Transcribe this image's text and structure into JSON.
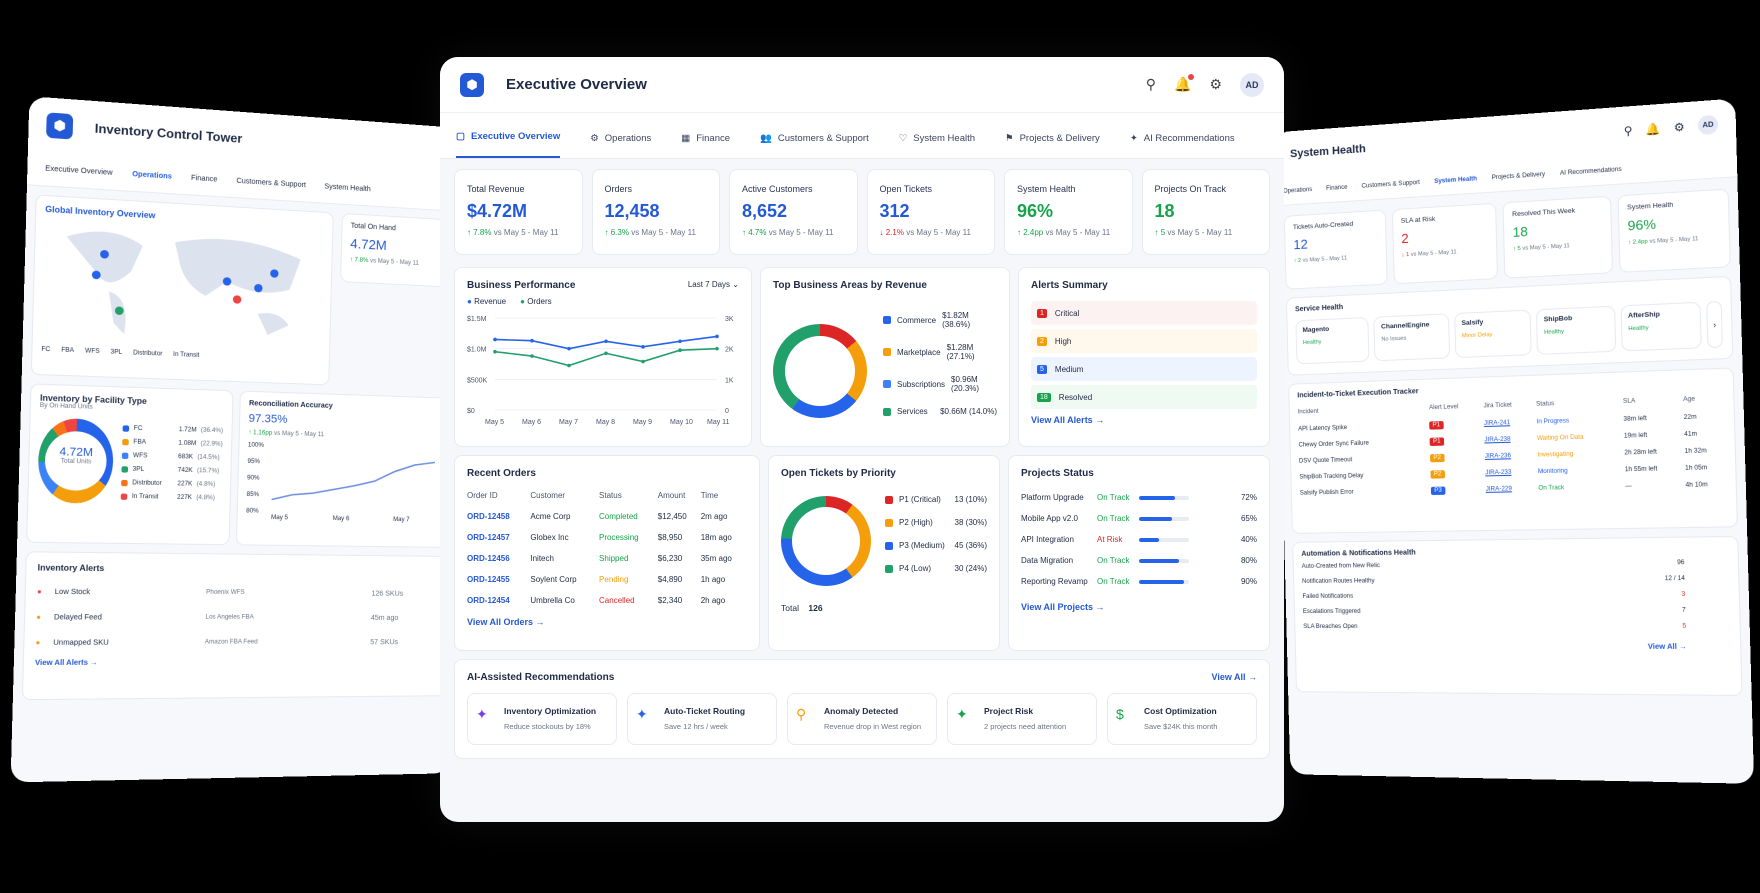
{
  "left": {
    "title": "Inventory Control Tower",
    "tabs": [
      "Executive Overview",
      "Operations",
      "Finance",
      "Customers & Support",
      "System Health"
    ],
    "map_title": "Global Inventory Overview",
    "map_legend": [
      "FC",
      "FBA",
      "WFS",
      "3PL",
      "Distributor",
      "In Transit"
    ],
    "onhand": {
      "label": "Total On Hand",
      "value": "4.72M",
      "delta": "↑ 7.8%",
      "vs": "vs May 5 - May 11"
    },
    "facility": {
      "title": "Inventory by Facility Type",
      "subtitle": "By On Hand Units",
      "center_value": "4.72M",
      "center_label": "Total Units",
      "rows": [
        {
          "name": "FC",
          "value": "1.72M",
          "pct": "(36.4%)",
          "color": "#2563eb"
        },
        {
          "name": "FBA",
          "value": "1.08M",
          "pct": "(22.9%)",
          "color": "#f59e0b"
        },
        {
          "name": "WFS",
          "value": "683K",
          "pct": "(14.5%)",
          "color": "#3b82f6"
        },
        {
          "name": "3PL",
          "value": "742K",
          "pct": "(15.7%)",
          "color": "#22a06b"
        },
        {
          "name": "Distributor",
          "value": "227K",
          "pct": "(4.8%)",
          "color": "#f97316"
        },
        {
          "name": "In Transit",
          "value": "227K",
          "pct": "(4.8%)",
          "color": "#ef4444"
        }
      ]
    },
    "recon": {
      "title": "Reconciliation Accuracy",
      "value": "97.35%",
      "delta": "↑ 1.16pp",
      "vs": "vs May 5 - May 11",
      "yticks": [
        "100%",
        "95%",
        "90%",
        "85%",
        "80%"
      ],
      "xticks": [
        "May 5",
        "May 6",
        "May 7"
      ]
    },
    "alerts": {
      "title": "Inventory Alerts",
      "rows": [
        {
          "name": "Low Stock",
          "loc": "Phoenix WFS",
          "val": "126 SKUs",
          "color": "#ef4444"
        },
        {
          "name": "Delayed Feed",
          "loc": "Los Angeles FBA",
          "val": "45m ago",
          "color": "#f59e0b"
        },
        {
          "name": "Unmapped SKU",
          "loc": "Amazon FBA Feed",
          "val": "57 SKUs",
          "color": "#f59e0b"
        }
      ],
      "link": "View All Alerts →"
    }
  },
  "main": {
    "title": "Executive Overview",
    "avatar": "AD",
    "tabs": [
      {
        "label": "Executive Overview",
        "icon": "▢"
      },
      {
        "label": "Operations",
        "icon": "⚙"
      },
      {
        "label": "Finance",
        "icon": "▦"
      },
      {
        "label": "Customers & Support",
        "icon": "👥"
      },
      {
        "label": "System Health",
        "icon": "♡"
      },
      {
        "label": "Projects & Delivery",
        "icon": "⚑"
      },
      {
        "label": "AI Recommendations",
        "icon": "✦"
      }
    ],
    "kpis": [
      {
        "label": "Total Revenue",
        "value": "$4.72M",
        "delta": "↑ 7.8%",
        "vs": " vs May 5 - May 11",
        "color": "#2459d6",
        "dcolor": "#17a34a"
      },
      {
        "label": "Orders",
        "value": "12,458",
        "delta": "↑ 6.3%",
        "vs": " vs May 5 - May 11",
        "color": "#2459d6",
        "dcolor": "#17a34a"
      },
      {
        "label": "Active Customers",
        "value": "8,652",
        "delta": "↑ 4.7%",
        "vs": " vs May 5 - May 11",
        "color": "#2459d6",
        "dcolor": "#17a34a"
      },
      {
        "label": "Open Tickets",
        "value": "312",
        "delta": "↓ 2.1%",
        "vs": " vs May 5 - May 11",
        "color": "#2459d6",
        "dcolor": "#dc2626"
      },
      {
        "label": "System Health",
        "value": "96%",
        "delta": "↑ 2.4pp",
        "vs": " vs May 5 - May 11",
        "color": "#17a34a",
        "dcolor": "#17a34a"
      },
      {
        "label": "Projects On Track",
        "value": "18",
        "delta": "↑ 5",
        "vs": " vs May 5 - May 11",
        "color": "#17a34a",
        "dcolor": "#17a34a"
      }
    ],
    "perf": {
      "title": "Business Performance",
      "range": "Last 7 Days",
      "legend": [
        "Revenue",
        "Orders"
      ]
    },
    "areas": {
      "title": "Top Business Areas by Revenue",
      "rows": [
        {
          "name": "Commerce",
          "value": "$1.82M (38.6%)",
          "color": "#2563eb"
        },
        {
          "name": "Marketplace",
          "value": "$1.28M (27.1%)",
          "color": "#f59e0b"
        },
        {
          "name": "Subscriptions",
          "value": "$0.96M (20.3%)",
          "color": "#3b82f6"
        },
        {
          "name": "Services",
          "value": "$0.66M (14.0%)",
          "color": "#22a06b"
        }
      ]
    },
    "alerts": {
      "title": "Alerts Summary",
      "rows": [
        {
          "n": "1",
          "label": "Critical",
          "bg": "#fdf2f2",
          "c": "#dc2626"
        },
        {
          "n": "2",
          "label": "High",
          "bg": "#fff8ec",
          "c": "#f59e0b"
        },
        {
          "n": "5",
          "label": "Medium",
          "bg": "#eef4ff",
          "c": "#2563eb"
        },
        {
          "n": "18",
          "label": "Resolved",
          "bg": "#effaf3",
          "c": "#17a34a"
        }
      ],
      "link": "View All Alerts →"
    },
    "orders": {
      "title": "Recent Orders",
      "headers": [
        "Order ID",
        "Customer",
        "Status",
        "Amount",
        "Time"
      ],
      "rows": [
        [
          "ORD-12458",
          "Acme Corp",
          "Completed",
          "$12,450",
          "2m ago"
        ],
        [
          "ORD-12457",
          "Globex Inc",
          "Processing",
          "$8,950",
          "18m ago"
        ],
        [
          "ORD-12456",
          "Initech",
          "Shipped",
          "$6,230",
          "35m ago"
        ],
        [
          "ORD-12455",
          "Soylent Corp",
          "Pending",
          "$4,890",
          "1h ago"
        ],
        [
          "ORD-12454",
          "Umbrella Co",
          "Cancelled",
          "$2,340",
          "2h ago"
        ]
      ],
      "status_colors": [
        "#17a34a",
        "#17a34a",
        "#17a34a",
        "#f59e0b",
        "#dc2626"
      ],
      "link": "View All Orders →"
    },
    "tickets": {
      "title": "Open Tickets by Priority",
      "rows": [
        {
          "name": "P1 (Critical)",
          "value": "13 (10%)",
          "color": "#dc2626"
        },
        {
          "name": "P2 (High)",
          "value": "38 (30%)",
          "color": "#f59e0b"
        },
        {
          "name": "P3 (Medium)",
          "value": "45 (36%)",
          "color": "#2563eb"
        },
        {
          "name": "P4 (Low)",
          "value": "30 (24%)",
          "color": "#22a06b"
        }
      ],
      "total_label": "Total",
      "total": "126"
    },
    "projects": {
      "title": "Projects Status",
      "rows": [
        {
          "name": "Platform Upgrade",
          "status": "On Track",
          "pct": "72%",
          "c": "#17a34a",
          "fill": 0.72
        },
        {
          "name": "Mobile App v2.0",
          "status": "On Track",
          "pct": "65%",
          "c": "#17a34a",
          "fill": 0.65
        },
        {
          "name": "API Integration",
          "status": "At Risk",
          "pct": "40%",
          "c": "#dc2626",
          "fill": 0.4
        },
        {
          "name": "Data Migration",
          "status": "On Track",
          "pct": "80%",
          "c": "#17a34a",
          "fill": 0.8
        },
        {
          "name": "Reporting Revamp",
          "status": "On Track",
          "pct": "90%",
          "c": "#17a34a",
          "fill": 0.9
        }
      ],
      "link": "View All Projects →"
    },
    "ai": {
      "title": "AI-Assisted Recommendations",
      "link": "View All →",
      "rows": [
        {
          "t": "Inventory Optimization",
          "d": "Reduce stockouts by 18%",
          "icon": "✦",
          "c": "#7c3aed"
        },
        {
          "t": "Auto-Ticket Routing",
          "d": "Save 12 hrs / week",
          "icon": "✦",
          "c": "#2563eb"
        },
        {
          "t": "Anomaly Detected",
          "d": "Revenue drop in West region",
          "icon": "⚲",
          "c": "#f59e0b"
        },
        {
          "t": "Project Risk",
          "d": "2 projects need attention",
          "icon": "✦",
          "c": "#17a34a"
        },
        {
          "t": "Cost Optimization",
          "d": "Save $24K this month",
          "icon": "$",
          "c": "#17a34a"
        }
      ]
    }
  },
  "chart_data": {
    "type": "line",
    "x": [
      "May 5",
      "May 6",
      "May 7",
      "May 8",
      "May 9",
      "May 10",
      "May 11"
    ],
    "series": [
      {
        "name": "Revenue",
        "values": [
          1.15,
          1.13,
          1.0,
          1.12,
          1.03,
          1.12,
          1.2
        ]
      },
      {
        "name": "Orders",
        "values": [
          1900,
          1760,
          1450,
          1850,
          1580,
          1950,
          2000
        ]
      }
    ],
    "yticks_left": [
      "$1.5M",
      "$1.0M",
      "$500K",
      "$0"
    ],
    "yticks_right": [
      "3K",
      "2K",
      "1K",
      "0"
    ],
    "ylim_left": [
      0,
      1.5
    ],
    "ylim_right": [
      0,
      3000
    ],
    "colors": [
      "#2563eb",
      "#22a06b"
    ]
  },
  "right": {
    "title": "System Health",
    "tabs": [
      "Operations",
      "Finance",
      "Customers & Support",
      "System Health",
      "Projects & Delivery",
      "AI Recommendations"
    ],
    "kpis": [
      {
        "l": "Tickets Auto-Created",
        "v": "12",
        "d": "↑ 2",
        "vs": " vs May 5 - May 11",
        "c": "#2459d6",
        "dc": "#17a34a"
      },
      {
        "l": "SLA at Risk",
        "v": "2",
        "d": "↓ 1",
        "vs": " vs May 5 - May 11",
        "c": "#dc2626",
        "dc": "#dc2626"
      },
      {
        "l": "Resolved This Week",
        "v": "18",
        "d": "↑ 5",
        "vs": " vs May 5 - May 11",
        "c": "#17a34a",
        "dc": "#17a34a"
      },
      {
        "l": "System Health",
        "v": "96%",
        "d": "↑ 2.4pp",
        "vs": " vs May 5 - May 11",
        "c": "#17a34a",
        "dc": "#17a34a"
      }
    ],
    "service_title": "Service Health",
    "services": [
      {
        "n": "Magento",
        "s": "Healthy",
        "c": "#17a34a"
      },
      {
        "n": "ChannelEngine",
        "s": "No Issues",
        "c": "#6b7488"
      },
      {
        "n": "Salsify",
        "s": "Minor Delay",
        "c": "#f59e0b"
      },
      {
        "n": "ShipBob",
        "s": "Healthy",
        "c": "#17a34a"
      },
      {
        "n": "AfterShip",
        "s": "Healthy",
        "c": "#17a34a"
      }
    ],
    "tracker_title": "Incident-to-Ticket Execution Tracker",
    "tracker_headers": [
      "Incident",
      "Alert Level",
      "Jira Ticket",
      "Status",
      "SLA",
      "Age"
    ],
    "tracker_rows": [
      [
        "API Latency Spike",
        "P1",
        "JIRA-241",
        "In Progress",
        "38m left",
        "22m"
      ],
      [
        "Chewy Order Sync Failure",
        "P1",
        "JIRA-238",
        "Waiting On Data",
        "19m left",
        "41m"
      ],
      [
        "DSV Quote Timeout",
        "P2",
        "JIRA-236",
        "Investigating",
        "2h 28m left",
        "1h 32m"
      ],
      [
        "ShipBob Tracking Delay",
        "P2",
        "JIRA-233",
        "Monitoring",
        "1h 55m left",
        "1h 05m"
      ],
      [
        "Salsify Publish Error",
        "P3",
        "JIRA-229",
        "On Track",
        "—",
        "4h 10m"
      ]
    ],
    "tracker_colors": [
      "#dc2626",
      "#dc2626",
      "#f59e0b",
      "#f59e0b",
      "#2563eb"
    ],
    "status_colors": [
      "#2563eb",
      "#f59e0b",
      "#f59e0b",
      "#2563eb",
      "#17a34a"
    ],
    "auto_title": "Automation & Notifications Health",
    "auto_rows": [
      {
        "l": "Auto-Created from New Relic",
        "v": "96",
        "c": "#1f2a44"
      },
      {
        "l": "Notification Routes Healthy",
        "v": "12 / 14",
        "c": "#1f2a44"
      },
      {
        "l": "Failed Notifications",
        "v": "3",
        "c": "#dc2626"
      },
      {
        "l": "Escalations Triggered",
        "v": "7",
        "c": "#1f2a44"
      },
      {
        "l": "SLA Breaches Open",
        "v": "5",
        "c": "#dc2626"
      }
    ],
    "link": "View All →"
  }
}
